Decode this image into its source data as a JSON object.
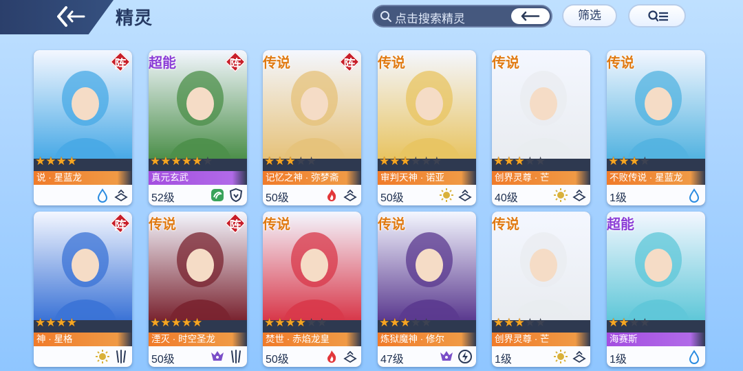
{
  "header": {
    "title": "精灵",
    "search_placeholder": "点击搜索精灵",
    "filter_label": "筛选"
  },
  "cards": [
    {
      "rarity": "",
      "formation": "阵",
      "name": "说 · 星蓝龙",
      "level": "",
      "stars_on": 4,
      "stars_total": 4,
      "bar": "legend",
      "icons": [
        "water-icon",
        "spirit-book-icon"
      ],
      "palette": "#48a9e6"
    },
    {
      "rarity": "超能",
      "formation": "阵",
      "name": "真元玄武",
      "level": "52级",
      "stars_on": 5,
      "stars_total": 6,
      "bar": "super",
      "icons": [
        "wind-icon",
        "shield-icon"
      ],
      "palette": "#4c8f4a"
    },
    {
      "rarity": "传说",
      "formation": "阵",
      "name": "记忆之神 · 弥梦斋",
      "level": "50级",
      "stars_on": 3,
      "stars_total": 5,
      "bar": "legend",
      "icons": [
        "fire-icon",
        "spirit-book-icon"
      ],
      "palette": "#e6c27a"
    },
    {
      "rarity": "传说",
      "formation": "",
      "name": "审判天神 · 诺亚",
      "level": "50级",
      "stars_on": 3,
      "stars_total": 6,
      "bar": "legend",
      "icons": [
        "light-icon",
        "spirit-book-icon"
      ],
      "palette": "#e8c462"
    },
    {
      "rarity": "传说",
      "formation": "",
      "name": "创界灵尊 · 芒",
      "level": "40级",
      "stars_on": 3,
      "stars_total": 5,
      "bar": "legend",
      "icons": [
        "light-icon",
        "spirit-book-icon"
      ],
      "palette": "#e9ecf0"
    },
    {
      "rarity": "传说",
      "formation": "",
      "name": "不败传说 · 星蓝龙",
      "level": "1级",
      "stars_on": 3,
      "stars_total": 4,
      "bar": "legend",
      "icons": [
        "water-icon"
      ],
      "palette": "#53b3e0"
    },
    {
      "rarity": "",
      "formation": "阵",
      "name": "神 · 星格",
      "level": "",
      "stars_on": 4,
      "stars_total": 4,
      "bar": "legend",
      "icons": [
        "light-icon",
        "claw-icon"
      ],
      "palette": "#3b73d6"
    },
    {
      "rarity": "传说",
      "formation": "阵",
      "name": "湮灭 · 时空圣龙",
      "level": "50级",
      "stars_on": 5,
      "stars_total": 5,
      "bar": "legend",
      "icons": [
        "dark-icon",
        "claw-icon"
      ],
      "palette": "#7a2430"
    },
    {
      "rarity": "传说",
      "formation": "",
      "name": "焚世 · 赤焰龙皇",
      "level": "50级",
      "stars_on": 4,
      "stars_total": 6,
      "bar": "legend",
      "icons": [
        "fire-icon",
        "spirit-book-icon"
      ],
      "palette": "#d8384a"
    },
    {
      "rarity": "传说",
      "formation": "",
      "name": "炼狱魔神 · 修尔",
      "level": "47级",
      "stars_on": 3,
      "stars_total": 5,
      "bar": "legend",
      "icons": [
        "dark-icon",
        "lightning-icon"
      ],
      "palette": "#5b3a8f"
    },
    {
      "rarity": "传说",
      "formation": "",
      "name": "创界灵尊 · 芒",
      "level": "1级",
      "stars_on": 3,
      "stars_total": 5,
      "bar": "legend",
      "icons": [
        "light-icon",
        "spirit-book-icon"
      ],
      "palette": "#e9ecf0"
    },
    {
      "rarity": "超能",
      "formation": "",
      "name": "海赛斯",
      "level": "1级",
      "stars_on": 2,
      "stars_total": 4,
      "bar": "super",
      "icons": [
        "water-icon"
      ],
      "palette": "#5fc7d8"
    }
  ]
}
